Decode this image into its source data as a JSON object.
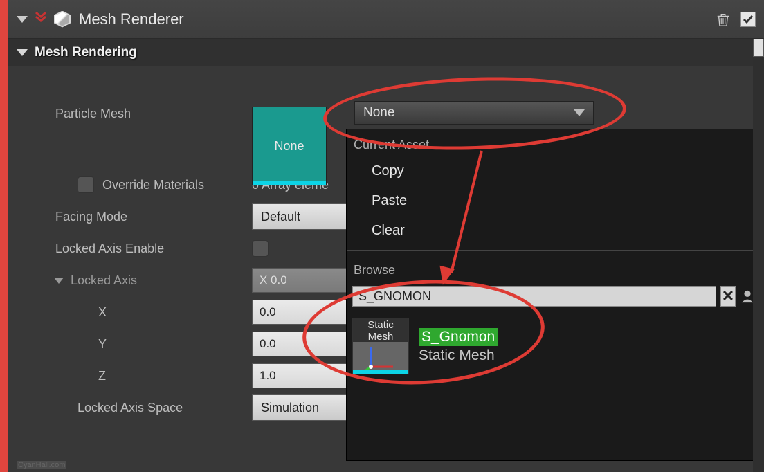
{
  "header": {
    "title": "Mesh Renderer",
    "enabled": true
  },
  "section": {
    "title": "Mesh Rendering"
  },
  "properties": {
    "particle_mesh_label": "Particle Mesh",
    "mesh_thumb_text": "None",
    "override_materials_label": "Override Materials",
    "array_summary": "0 Array eleme",
    "facing_mode_label": "Facing Mode",
    "facing_mode_value": "Default",
    "locked_axis_enable_label": "Locked Axis Enable",
    "locked_axis_label": "Locked Axis",
    "axis_x_label": "X",
    "axis_y_label": "Y",
    "axis_z_label": "Z",
    "locked_axis_x_prefix": "X  0.0",
    "locked_axis_x_value": "0.0",
    "locked_axis_y_value": "0.0",
    "locked_axis_z_value": "1.0",
    "locked_axis_space_label": "Locked Axis Space",
    "locked_axis_space_value": "Simulation"
  },
  "asset_dropdown": {
    "current": "None"
  },
  "popup": {
    "section_current": "Current Asset",
    "item_copy": "Copy",
    "item_paste": "Paste",
    "item_clear": "Clear",
    "section_browse": "Browse",
    "search_value": "S_GNOMON",
    "result_thumb_label": "Static\nMesh",
    "result_name": "S_Gnomon",
    "result_type": "Static Mesh"
  },
  "watermark": "CyanHall.com"
}
